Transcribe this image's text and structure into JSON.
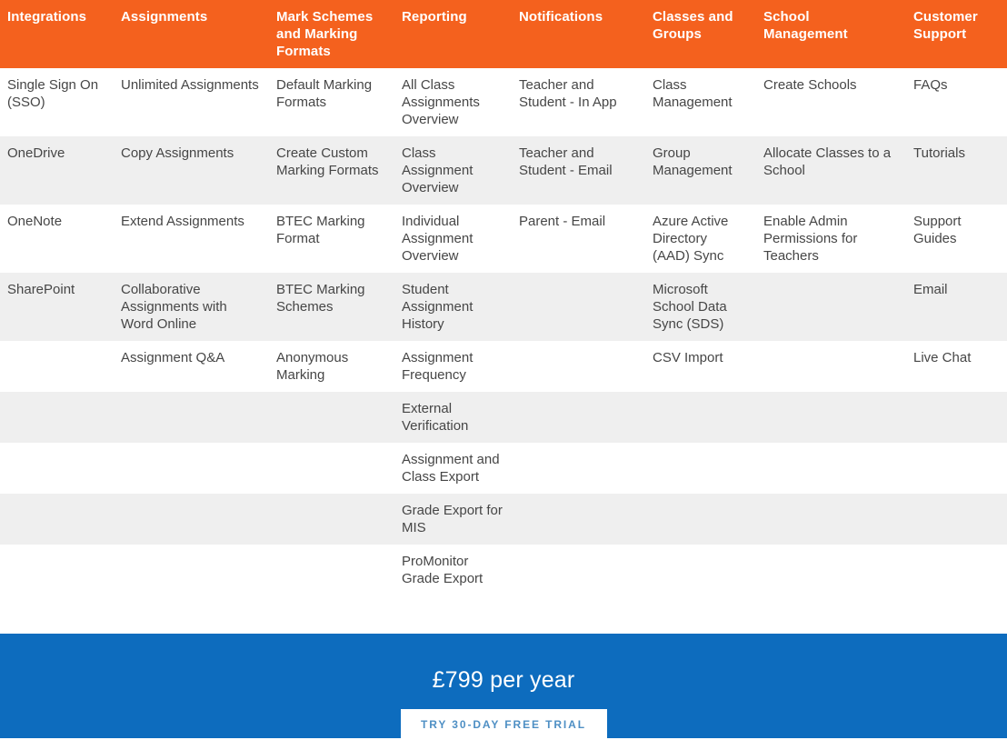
{
  "colors": {
    "header_orange": "#f4611e",
    "cta_blue": "#0d6cbe",
    "zebra_grey": "#efefef",
    "body_text": "#464646",
    "cta_button_text": "#4e8fc4"
  },
  "table": {
    "columns": [
      "Integrations",
      "Assignments",
      "Mark Schemes and Marking Formats",
      "Reporting",
      "Notifications",
      "Classes and Groups",
      "School Management",
      "Customer Support"
    ],
    "rows": [
      [
        "Single Sign On (SSO)",
        "Unlimited Assignments",
        "Default Marking Formats",
        "All Class Assignments Overview",
        "Teacher and Student - In App",
        "Class Management",
        "Create Schools",
        "FAQs"
      ],
      [
        "OneDrive",
        "Copy Assignments",
        "Create Custom Marking Formats",
        "Class Assignment Overview",
        "Teacher and Student - Email",
        "Group Management",
        "Allocate Classes to a School",
        "Tutorials"
      ],
      [
        "OneNote",
        "Extend Assignments",
        "BTEC Marking Format",
        "Individual Assignment Overview",
        "Parent - Email",
        "Azure Active Directory (AAD) Sync",
        "Enable Admin Permissions for Teachers",
        "Support Guides"
      ],
      [
        "SharePoint",
        "Collaborative Assignments with Word Online",
        "BTEC Marking Schemes",
        "Student Assignment History",
        "",
        "Microsoft School Data Sync (SDS)",
        "",
        "Email"
      ],
      [
        "",
        "Assignment Q&A",
        "Anonymous Marking",
        "Assignment Frequency",
        "",
        "CSV Import",
        "",
        "Live Chat"
      ],
      [
        "",
        "",
        "",
        "External Verification",
        "",
        "",
        "",
        ""
      ],
      [
        "",
        "",
        "",
        "Assignment and Class Export",
        "",
        "",
        "",
        ""
      ],
      [
        "",
        "",
        "",
        "Grade Export for MIS",
        "",
        "",
        "",
        ""
      ],
      [
        "",
        "",
        "",
        "ProMonitor Grade Export",
        "",
        "",
        "",
        ""
      ]
    ]
  },
  "cta": {
    "price": "£799 per year",
    "button_label": "TRY 30-DAY FREE TRIAL"
  }
}
